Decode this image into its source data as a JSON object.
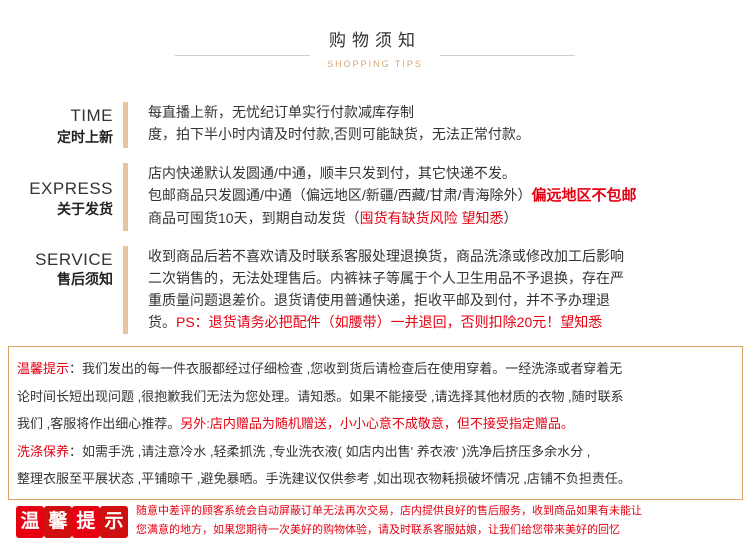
{
  "header": {
    "title": "购物须知",
    "subtitle": "SHOPPING TIPS"
  },
  "sections": {
    "time": {
      "en": "TIME",
      "cn": "定时上新",
      "lines": [
        "每直播上新，无忧纪订单实行付款减库存制",
        "度，拍下半小时内请及时付款,否则可能缺货，无法正常付款。"
      ]
    },
    "express": {
      "en": "EXPRESS",
      "cn": "关于发货",
      "line1": "店内快递默认发圆通/中通，顺丰只发到付，其它快递不发。",
      "line2_a": "包邮商品只发圆通/中通（偏远地区/新疆/西藏/甘肃/青海除外）",
      "line2_b": "偏远地区不包邮",
      "line3_a": "商品可囤货10天，到期自动发货（",
      "line3_b": "囤货有缺货风险 望知悉",
      "line3_c": "）"
    },
    "service": {
      "en": "SERVICE",
      "cn": "售后须知",
      "line1": "收到商品后若不喜欢请及时联系客服处理退换货，商品洗涤或修改加工后影响",
      "line2": "二次销售的，无法处理售后。内裤袜子等属于个人卫生用品不予退换，存在严",
      "line3": "重质量问题退差价。退货请使用普通快递，拒收平邮及到付，并不予办理退",
      "line4_a": "货。",
      "line4_b": "PS：退货请务必把配件（如腰带）一并退回，否则扣除20元！望知悉"
    }
  },
  "notice": {
    "tip_label": "温馨提示",
    "tip_text_1": "：我们发出的每一件衣服都经过仔细检查 ,您收到货后请检查后在使用穿着。一经洗涤或者穿着无",
    "tip_text_2": "论时间长短出现问题  ,很抱歉我们无法为您处理。请知悉。如果不能接受 ,请选择其他材质的衣物 ,随时联系",
    "tip_text_3": "我们 ,客服将作出细心推荐。",
    "tip_highlight": "另外:店内赠品为随机赠送，小小心意不成敬意，但不接受指定赠品。",
    "wash_label": "洗涤保养",
    "wash_text_1": "：如需手洗 ,请注意冷水 ,轻柔抓洗 ,专业洗衣液( 如店内出售'      养衣液'     )洗净后挤压多余水分 ,",
    "wash_text_2": "整理衣服至平展状态 ,平铺晾干 ,避免暴晒。手洗建议仅供参考 ,如出现衣物耗损破坏情况 ,店铺不负担责任。"
  },
  "bottom": {
    "badge_chars": [
      "温",
      "馨",
      "提",
      "示"
    ],
    "line1": "随意中差评的顾客系统会自动屏蔽订单无法再次交易，店内提供良好的售后服务，收到商品如果有未能让",
    "line2": "您满意的地方，如果您期待一次美好的购物体验，请及时联系客服姑娘，让我们给您带来美好的回忆"
  },
  "colors": {
    "accent_red": "#e60012",
    "bar_tan": "#e8c4a0",
    "subtitle_tan": "#d4a87c",
    "notice_border": "#e0a060"
  }
}
